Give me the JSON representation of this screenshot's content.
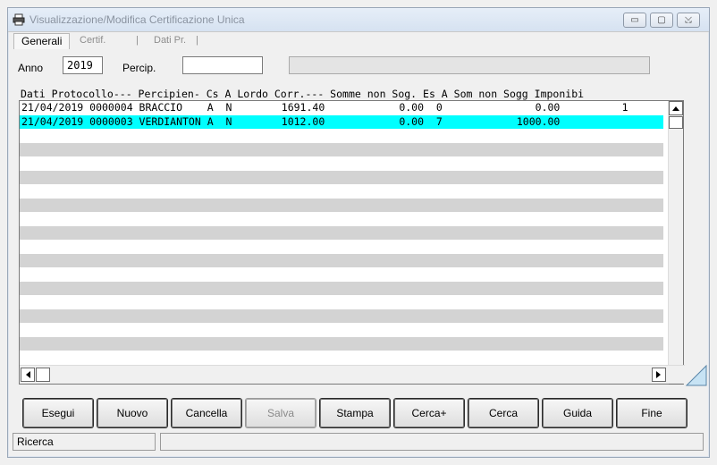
{
  "window": {
    "title": "Visualizzazione/Modifica Certificazione Unica",
    "controls": {
      "minimize": "▭",
      "maximize": "▢",
      "close": "⤩"
    }
  },
  "tabs": {
    "active": "Generali",
    "others": [
      "Certif.",
      "|",
      "Dati Pr.",
      "|"
    ]
  },
  "filters": {
    "anno_label": "Anno",
    "anno_value": "2019",
    "percip_label": "Percip.",
    "percip_value": "",
    "info_value": ""
  },
  "grid": {
    "header": "Dati Protocollo--- Percipien- Cs A Lordo Corr.--- Somme non Sog. Es A Som non Sogg Imponibi",
    "rows": [
      "21/04/2019 0000004 BRACCIO    A  N        1691.40            0.00  0               0.00          1",
      "21/04/2019 0000003 VERDIANTON A  N        1012.00            0.00  7            1000.00"
    ],
    "selected_index": 1
  },
  "buttons": {
    "esegui": "Esegui",
    "nuovo": "Nuovo",
    "cancella": "Cancella",
    "salva": "Salva",
    "stampa": "Stampa",
    "cercaplus": "Cerca+",
    "cerca": "Cerca",
    "guida": "Guida",
    "fine": "Fine"
  },
  "status": {
    "left": "Ricerca",
    "right": ""
  }
}
